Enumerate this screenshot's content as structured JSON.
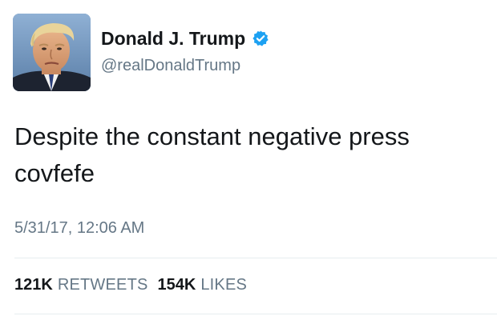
{
  "author": {
    "display_name": "Donald J. Trump",
    "handle": "@realDonaldTrump",
    "verified": true,
    "verified_color": "#1da1f2",
    "avatar_icon": "profile-photo"
  },
  "tweet": {
    "text_lines": [
      "Despite the constant negative press",
      "covfefe"
    ],
    "timestamp": "5/31/17, 12:06 AM"
  },
  "stats": {
    "retweets_count": "121K",
    "retweets_label": "RETWEETS",
    "likes_count": "154K",
    "likes_label": "LIKES"
  },
  "colors": {
    "text_primary": "#14171a",
    "text_secondary": "#657786",
    "divider": "#e6ecf0"
  }
}
